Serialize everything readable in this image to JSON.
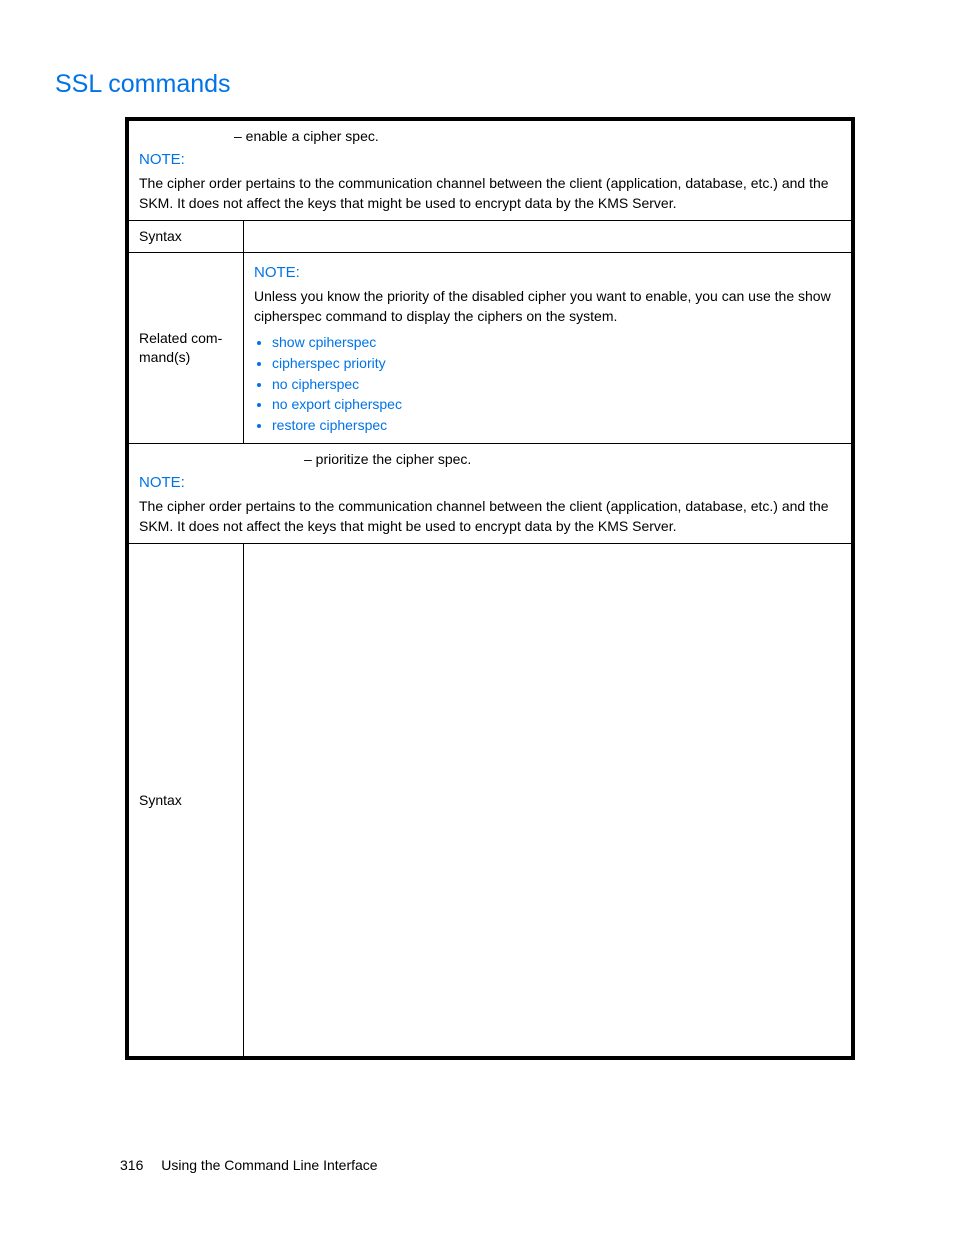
{
  "heading": "SSL commands",
  "row1": {
    "desc": "– enable a cipher spec.",
    "noteTitle": "NOTE:",
    "noteBody": "The cipher order pertains to the communication channel between the client (application, database, etc.) and the SKM. It does not affect the keys that might be used to encrypt data by the KMS Server."
  },
  "row2": {
    "label": "Syntax"
  },
  "row3": {
    "label": "Related com­mand(s)",
    "noteTitle": "NOTE:",
    "noteBody": "Unless you know the priority of the disabled cipher you want to enable, you can use the show cipherspec command to display the ciphers on the system.",
    "items": [
      "show cpiherspec",
      "cipherspec priority",
      "no cipherspec",
      "no export cipherspec",
      "restore cipherspec"
    ]
  },
  "row4": {
    "desc": "– prioritize the cipher spec.",
    "noteTitle": "NOTE:",
    "noteBody": "The cipher order pertains to the communication channel between the client (application, database, etc.) and the SKM. It does not affect the keys that might be used to encrypt data by the KMS Server."
  },
  "row5": {
    "label": "Syntax"
  },
  "footer": {
    "page": "316",
    "title": "Using the Command Line Interface"
  }
}
